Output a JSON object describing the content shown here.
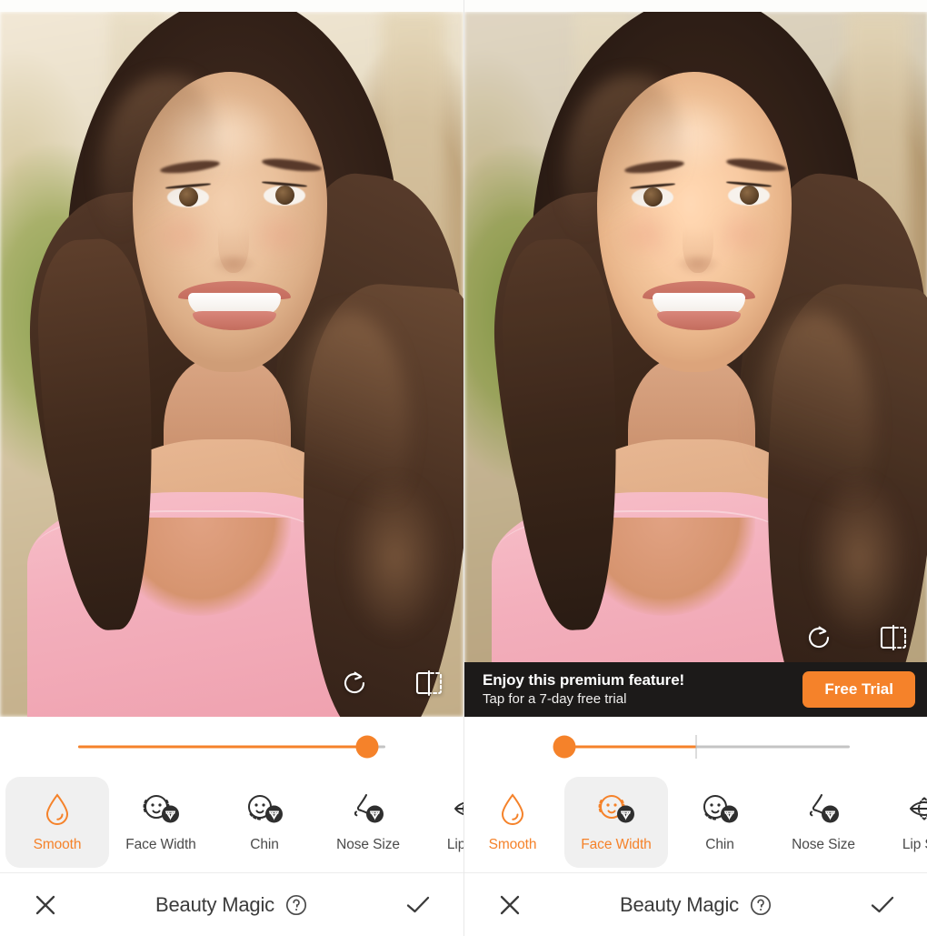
{
  "app": {
    "title": "Beauty Magic",
    "accent_color": "#f5822a",
    "banner_bg": "#1c1a19",
    "active_chip_bg": "#f0f0f0",
    "label_color": "#4a4a4a"
  },
  "panels": [
    {
      "id": "left",
      "photo_actions": [
        {
          "name": "reset-icon",
          "label": "Reset"
        },
        {
          "name": "compare-icon",
          "label": "Compare"
        }
      ],
      "banner": null,
      "slider": {
        "name": "intensity-slider",
        "value": 100,
        "min": 0,
        "max": 100,
        "has_center_tick": false,
        "fill_percent": 100,
        "thumb_percent": 100
      },
      "tools": [
        {
          "label": "Smooth",
          "icon": "droplet-icon",
          "active": true,
          "premium": false
        },
        {
          "label": "Face Width",
          "icon": "face-width-icon",
          "active": false,
          "premium": true
        },
        {
          "label": "Chin",
          "icon": "chin-icon",
          "active": false,
          "premium": true
        },
        {
          "label": "Nose Size",
          "icon": "nose-size-icon",
          "active": false,
          "premium": true
        },
        {
          "label": "Lip Size",
          "icon": "lip-size-icon",
          "active": false,
          "premium": true
        }
      ],
      "bottombar": {
        "cancel": "close-icon",
        "title": "Beauty Magic",
        "help": "help-icon",
        "confirm": "checkmark-icon"
      }
    },
    {
      "id": "right",
      "photo_actions": [
        {
          "name": "reset-icon",
          "label": "Reset"
        },
        {
          "name": "compare-icon",
          "label": "Compare"
        }
      ],
      "banner": {
        "title": "Enjoy this premium feature!",
        "subtitle": "Tap for a 7-day free trial",
        "cta": "Free Trial"
      },
      "slider": {
        "name": "intensity-slider",
        "value": -50,
        "min": -50,
        "max": 50,
        "has_center_tick": true,
        "fill_percent": 50,
        "thumb_percent": 0
      },
      "tools": [
        {
          "label": "Smooth",
          "icon": "droplet-icon",
          "active": false,
          "premium": false
        },
        {
          "label": "Face Width",
          "icon": "face-width-icon",
          "active": true,
          "premium": true
        },
        {
          "label": "Chin",
          "icon": "chin-icon",
          "active": false,
          "premium": true
        },
        {
          "label": "Nose Size",
          "icon": "nose-size-icon",
          "active": false,
          "premium": true
        },
        {
          "label": "Lip Size",
          "icon": "lip-size-icon",
          "active": false,
          "premium": true
        }
      ],
      "bottombar": {
        "cancel": "close-icon",
        "title": "Beauty Magic",
        "help": "help-icon",
        "confirm": "checkmark-icon"
      }
    }
  ]
}
